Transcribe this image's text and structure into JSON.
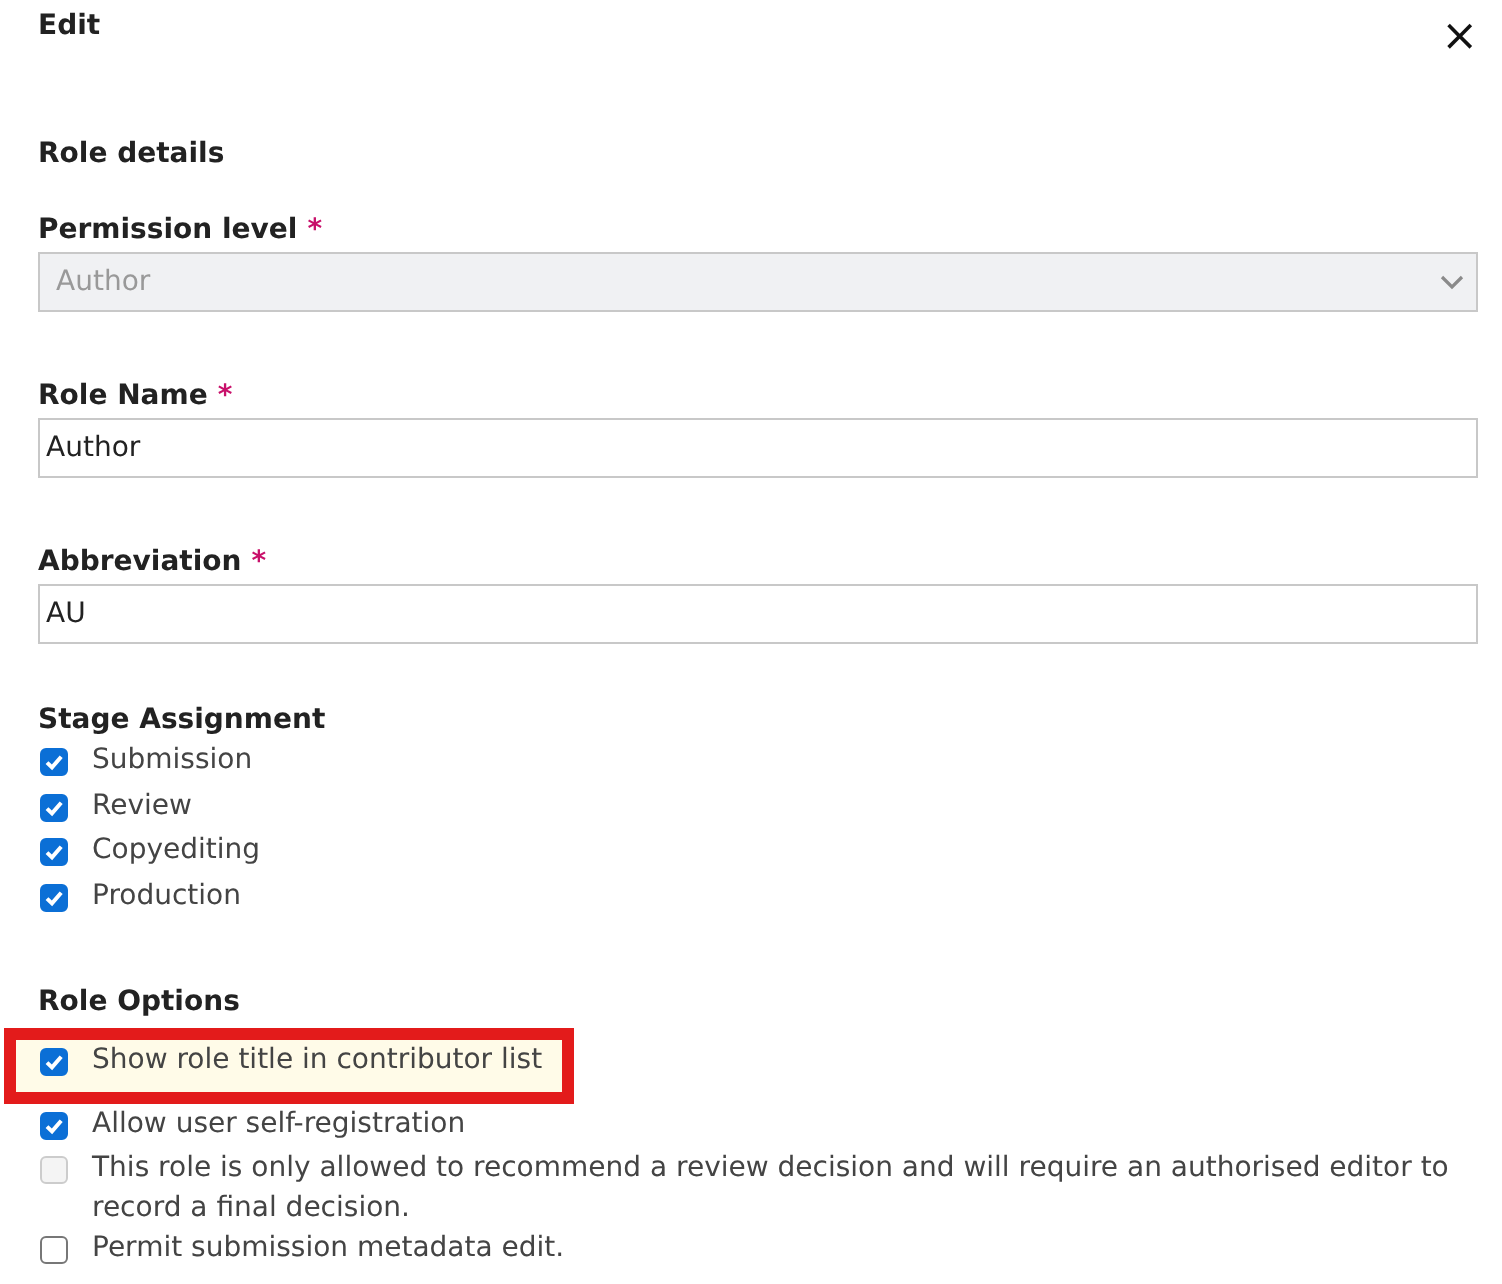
{
  "window": {
    "title": "Edit",
    "close": "×"
  },
  "section_title": "Role details",
  "fields": [
    {
      "kind": "select",
      "label": "Permission level",
      "required_mark": "*",
      "value": "Author",
      "disabled": true
    },
    {
      "kind": "text",
      "label": "Role Name",
      "required_mark": "*",
      "value": "Author",
      "disabled": false
    },
    {
      "kind": "text",
      "label": "Abbreviation",
      "required_mark": "*",
      "value": "AU",
      "disabled": false
    }
  ],
  "stage_assignment": {
    "label": "Stage Assignment",
    "items": [
      {
        "label": "Submission",
        "checked": true
      },
      {
        "label": "Review",
        "checked": true
      },
      {
        "label": "Copyediting",
        "checked": true
      },
      {
        "label": "Production",
        "checked": true
      }
    ]
  },
  "role_options": {
    "label": "Role Options",
    "items": [
      {
        "label": "Show role title in contributor list",
        "checked": true,
        "disabled": false,
        "highlighted": true
      },
      {
        "label": "Allow user self-registration",
        "checked": true,
        "disabled": false,
        "highlighted": false
      },
      {
        "label": "This role is only allowed to recommend a review decision and will require an authorised editor to record a final decision.",
        "checked": false,
        "disabled": true,
        "highlighted": false
      },
      {
        "label": "Permit submission metadata edit.",
        "checked": false,
        "disabled": false,
        "highlighted": false
      }
    ]
  }
}
